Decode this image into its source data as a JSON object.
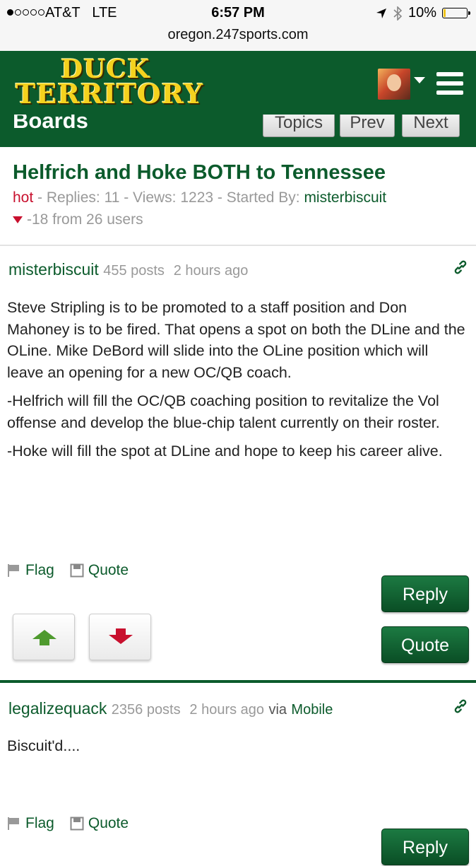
{
  "status_bar": {
    "carrier": "AT&T",
    "network": "LTE",
    "time": "6:57 PM",
    "battery_percent": "10%",
    "battery_level": 0.1,
    "url": "oregon.247sports.com"
  },
  "header": {
    "logo_line1": "DUCK",
    "logo_line2": "TERRITORY"
  },
  "boards_nav": {
    "title": "Boards",
    "topics": "Topics",
    "prev": "Prev",
    "next": "Next"
  },
  "thread": {
    "title": "Helfrich and Hoke BOTH to Tennessee",
    "hot": "hot",
    "replies_text": " - Replies: 11 - Views: 1223 - Started By: ",
    "started_by": "misterbiscuit",
    "vote_summary": "-18 from 26 users"
  },
  "posts": [
    {
      "author": "misterbiscuit",
      "posts_count": "455 posts",
      "time": "2 hours ago",
      "paragraphs": [
        "Steve Stripling is to be promoted to a staff position and Don Mahoney is to be fired. That opens a spot on both the DLine and the OLine. Mike DeBord will slide into the OLine position which will leave an opening for a new OC/QB coach.",
        "-Helfrich will fill the OC/QB coaching position to revitalize the Vol offense and develop the blue-chip talent currently on their roster.",
        "-Hoke will fill the spot at DLine and hope to keep his career alive."
      ],
      "flag": "Flag",
      "quote": "Quote",
      "reply_button": "Reply",
      "quote_button": "Quote"
    },
    {
      "author": "legalizequack",
      "posts_count": "2356 posts",
      "time": "2 hours ago",
      "via": "via",
      "via_source": "Mobile",
      "paragraphs": [
        "Biscuit'd...."
      ],
      "flag": "Flag",
      "quote": "Quote",
      "reply_button": "Reply"
    }
  ],
  "colors": {
    "brand_green": "#0c5b2c",
    "hot_red": "#c8102e",
    "logo_gold": "#f5d21e"
  }
}
